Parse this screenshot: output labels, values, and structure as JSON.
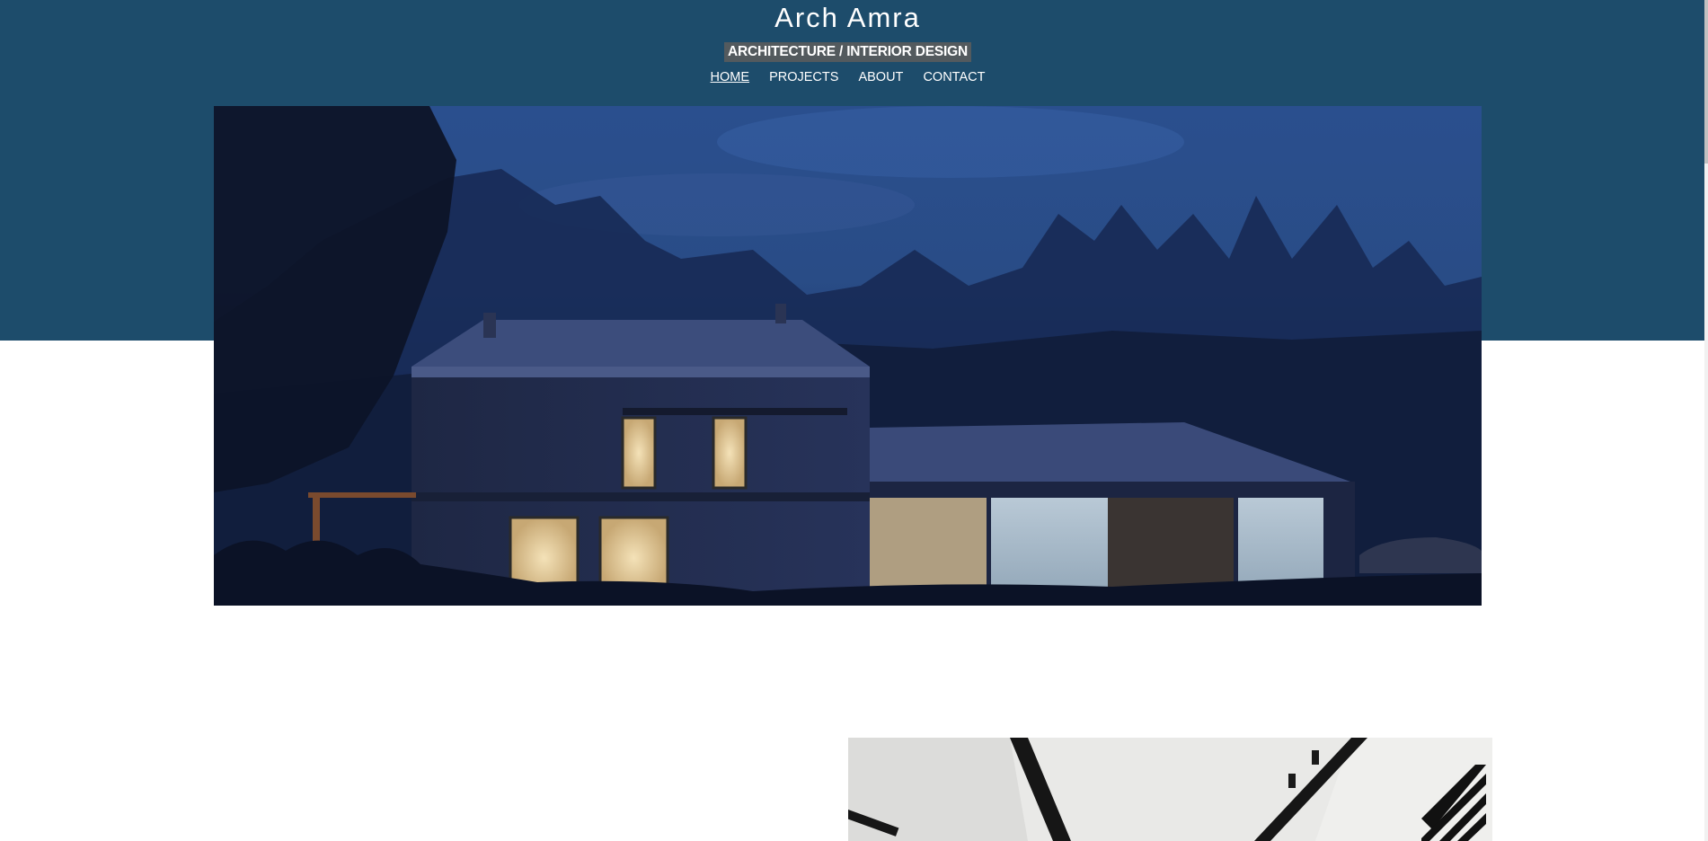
{
  "site": {
    "title": "Arch Amra",
    "tagline": "ARCHITECTURE / INTERIOR DESIGN"
  },
  "nav": {
    "items": [
      {
        "label": "HOME",
        "active": true
      },
      {
        "label": "PROJECTS",
        "active": false
      },
      {
        "label": "ABOUT",
        "active": false
      },
      {
        "label": "CONTACT",
        "active": false
      }
    ]
  },
  "colors": {
    "header_bg": "#1d4c6b",
    "tagline_bg": "#535a5e",
    "text": "#ffffff"
  },
  "images": {
    "hero": "house-at-night-photo",
    "secondary": "interior-ceiling-photo"
  }
}
